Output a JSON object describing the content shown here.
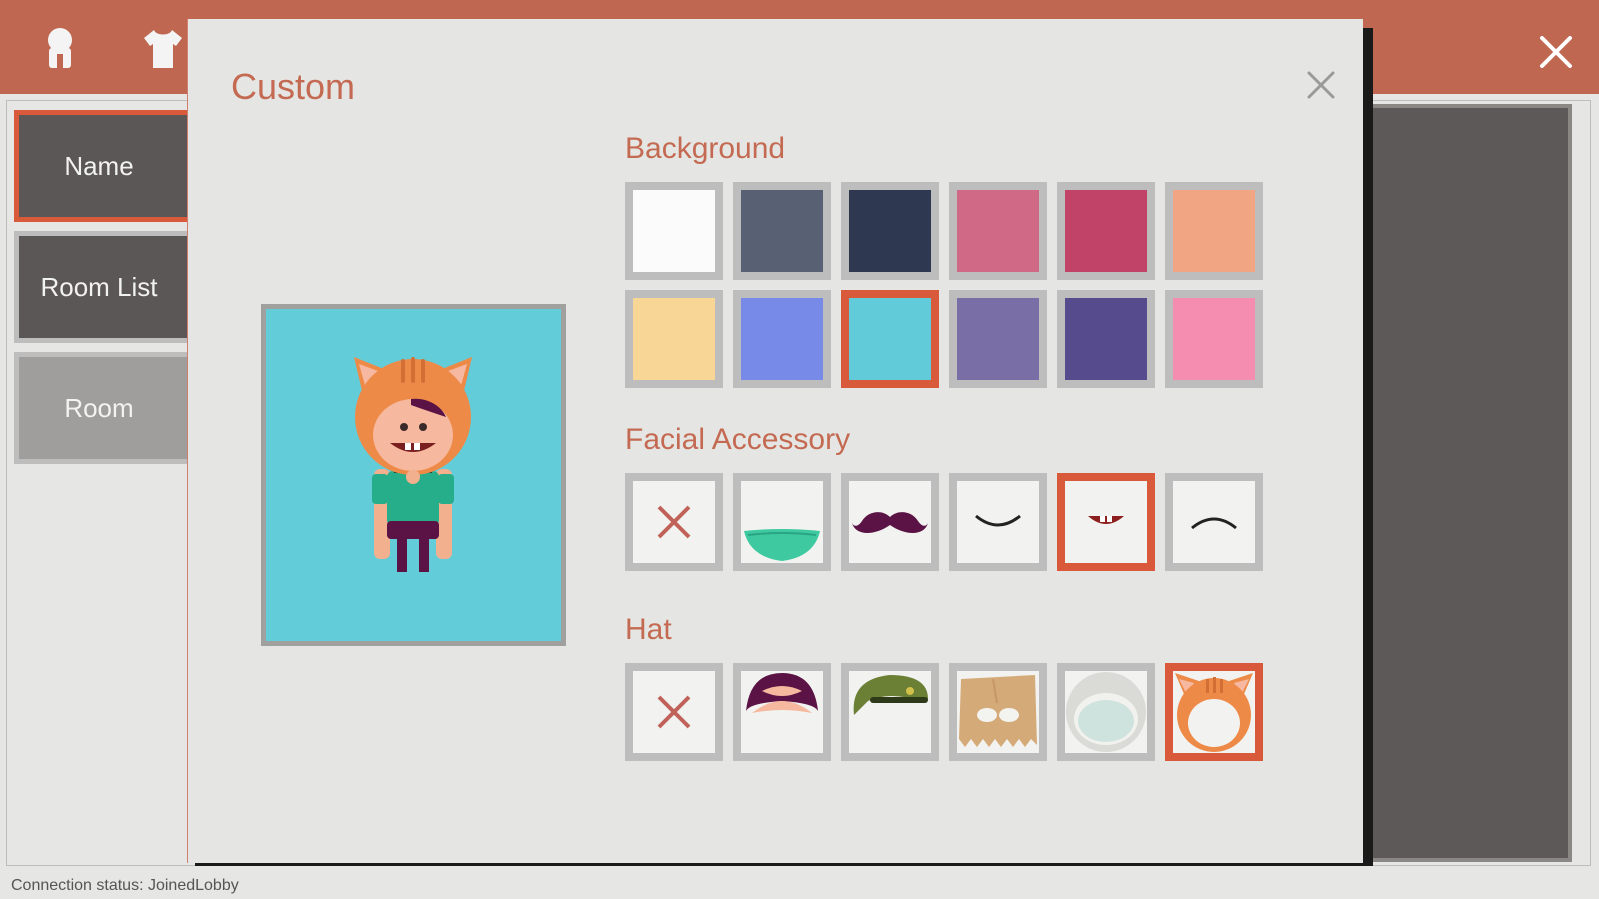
{
  "topbar": {
    "icons": [
      "avatar-icon",
      "shirt-icon"
    ],
    "close_icon": "close-icon"
  },
  "sidebar": {
    "items": [
      {
        "label": "Name",
        "state": "selected"
      },
      {
        "label": "Room List",
        "state": "normal"
      },
      {
        "label": "Room",
        "state": "disabled"
      }
    ]
  },
  "status": {
    "text": "Connection status: JoinedLobby"
  },
  "modal": {
    "title": "Custom",
    "close_icon": "close-icon",
    "sections": {
      "background": {
        "title": "Background",
        "colors": [
          "#fbfbfb",
          "#586073",
          "#2e3851",
          "#d06985",
          "#c24368",
          "#f2a583",
          "#f8d796",
          "#788ae8",
          "#62cbd9",
          "#7a6ea6",
          "#564b8c",
          "#f58db1"
        ],
        "selected_index": 8
      },
      "facial_accessory": {
        "title": "Facial Accessory",
        "options": [
          "none",
          "teal-mask",
          "mustache",
          "smile",
          "buck-teeth",
          "frown"
        ],
        "selected_index": 4
      },
      "hat": {
        "title": "Hat",
        "options": [
          "none",
          "hair",
          "beret",
          "paper-bag",
          "helmet",
          "cat-hood"
        ],
        "selected_index": 5
      }
    }
  },
  "colors": {
    "accent": "#bf6750",
    "selected": "#d95a3b",
    "title_text": "#c46a52"
  }
}
